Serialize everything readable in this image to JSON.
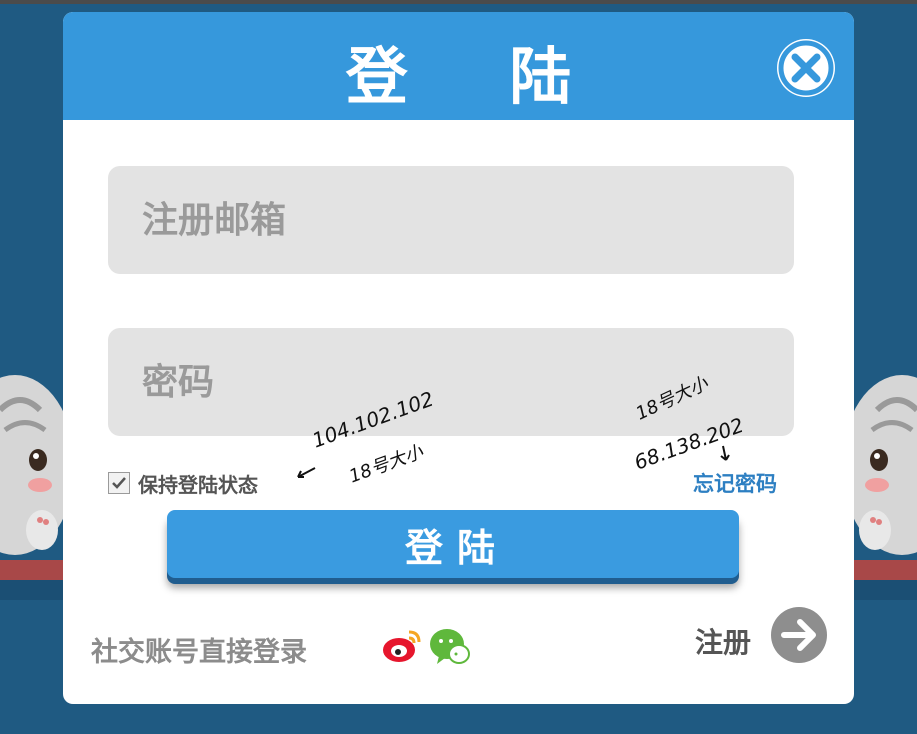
{
  "dialog": {
    "title": "登 陆",
    "close_icon": "close-icon"
  },
  "form": {
    "email_placeholder": "注册邮箱",
    "password_placeholder": "密码",
    "remember_label": "保持登陆状态",
    "remember_checked": true,
    "forgot_label": "忘记密码",
    "login_label": "登陆"
  },
  "footer": {
    "social_label": "社交账号直接登录",
    "social_icons": [
      "weibo-icon",
      "wechat-icon"
    ],
    "register_label": "注册",
    "register_icon": "arrow-right-icon"
  },
  "annotations": {
    "left_color_code": "104.102.102",
    "left_size_note": "18号大小",
    "right_size_note": "18号大小",
    "right_color_code": "68.138.202"
  },
  "colors": {
    "background": "#1f5a82",
    "header": "#3698dc",
    "login_button": "#3a9be0",
    "forgot_link": "#2d7fc2",
    "field_bg": "#e3e3e3"
  }
}
